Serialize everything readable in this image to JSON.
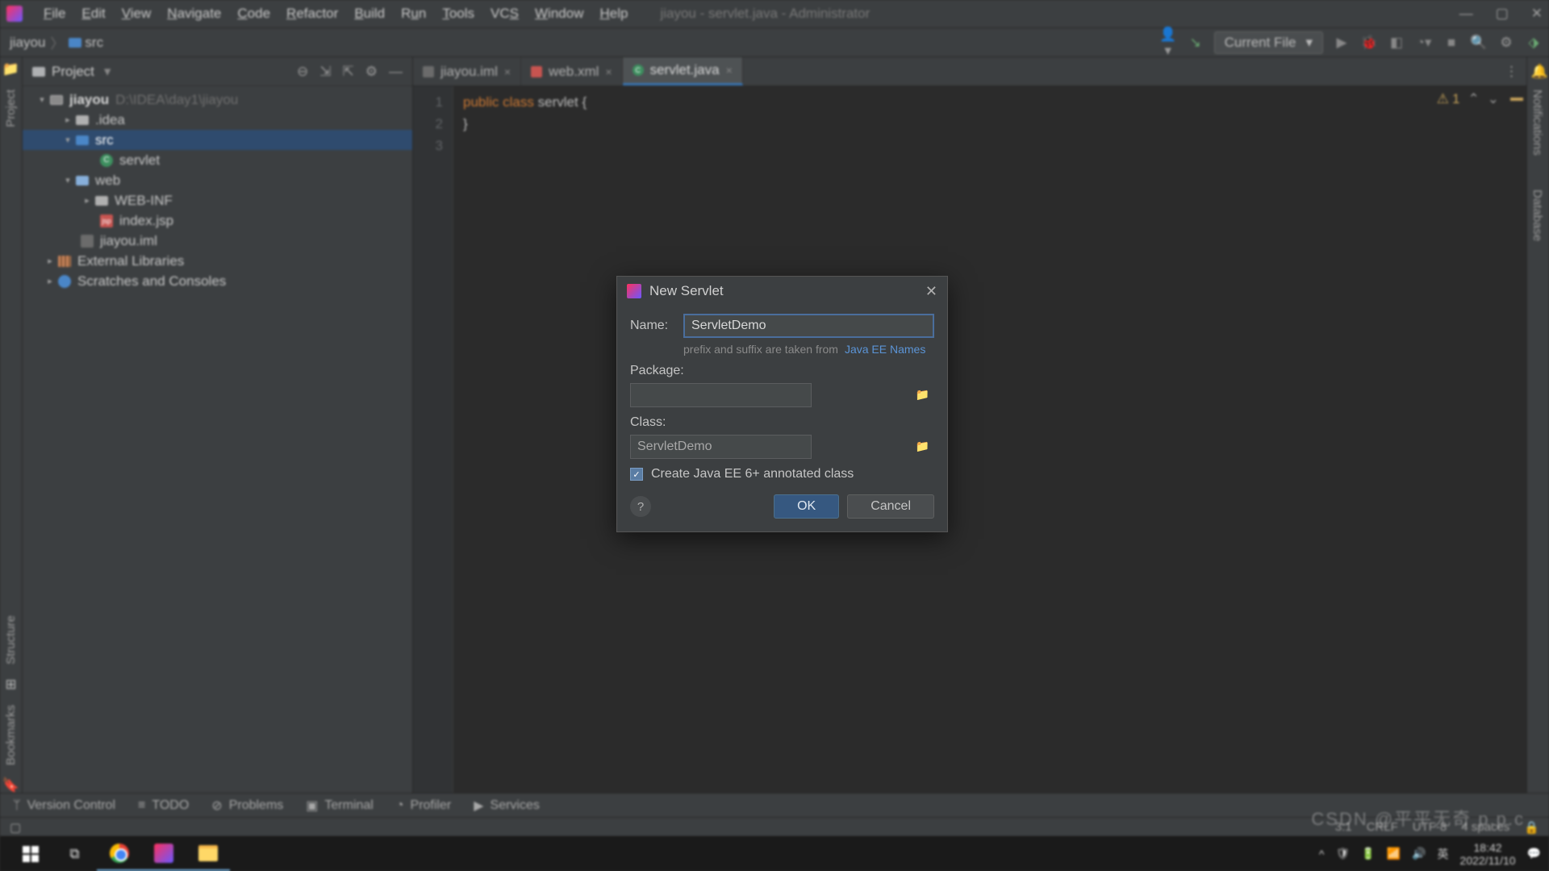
{
  "window": {
    "title": "jiayou - servlet.java - Administrator",
    "menu": [
      "File",
      "Edit",
      "View",
      "Navigate",
      "Code",
      "Refactor",
      "Build",
      "Run",
      "Tools",
      "VCS",
      "Window",
      "Help"
    ]
  },
  "breadcrumb": {
    "project": "jiayou",
    "folder": "src"
  },
  "toolbar": {
    "current_file": "Current File"
  },
  "project_panel": {
    "title": "Project",
    "root": {
      "name": "jiayou",
      "path": "D:\\IDEA\\day1\\jiayou"
    },
    "items": {
      "idea": ".idea",
      "src": "src",
      "servlet": "servlet",
      "web": "web",
      "webinf": "WEB-INF",
      "indexjsp": "index.jsp",
      "iml": "jiayou.iml",
      "ext": "External Libraries",
      "scratch": "Scratches and Consoles"
    }
  },
  "tabs": {
    "t1": "jiayou.iml",
    "t2": "web.xml",
    "t3": "servlet.java"
  },
  "editor": {
    "line1": "1",
    "line2": "2",
    "line3": "3",
    "kw_public": "public",
    "kw_class": "class",
    "cls_name": "servlet",
    "brace_open": "{",
    "brace_close": "}",
    "warn_count": "1"
  },
  "dialog": {
    "title": "New Servlet",
    "name_label": "Name:",
    "name_value": "ServletDemo",
    "hint_prefix": "prefix and suffix are taken from",
    "hint_link": "Java EE Names",
    "package_label": "Package:",
    "package_value": "",
    "class_label": "Class:",
    "class_value": "ServletDemo",
    "check_label": "Create Java EE 6+ annotated class",
    "ok": "OK",
    "cancel": "Cancel"
  },
  "bottom_tools": {
    "vc": "Version Control",
    "todo": "TODO",
    "problems": "Problems",
    "terminal": "Terminal",
    "profiler": "Profiler",
    "services": "Services"
  },
  "status": {
    "pos": "3:1",
    "eol": "CRLF",
    "enc": "UTF-8",
    "indent": "4 spaces"
  },
  "right_gutter": {
    "notif": "Notifications",
    "db": "Database"
  },
  "left_gutter": {
    "project": "Project",
    "structure": "Structure",
    "bookmarks": "Bookmarks"
  },
  "taskbar": {
    "time": "18:42",
    "date": "2022/11/10",
    "ime": "英"
  },
  "watermark": "CSDN @平平无奇 p.p.c"
}
